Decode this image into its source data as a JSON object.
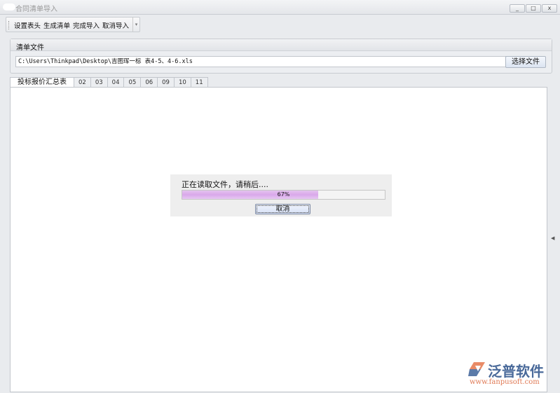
{
  "window": {
    "title": "合同清单导入",
    "minimize": "_",
    "maximize": "□",
    "close": "x"
  },
  "toolbar": {
    "set_header": "设置表头",
    "generate_list": "生成清单",
    "finish_import": "完成导入",
    "cancel_import": "取消导入",
    "more": "▾"
  },
  "file_group": {
    "title": "清单文件",
    "path": "C:\\Users\\Thinkpad\\Desktop\\吉图珲一标 表4-5、4-6.xls",
    "choose_label": "选择文件"
  },
  "tabs": [
    "投标报价汇总表",
    "02",
    "03",
    "04",
    "05",
    "06",
    "09",
    "10",
    "11"
  ],
  "progress": {
    "message": "正在读取文件，请稍后....",
    "percent": 67,
    "percent_label": "67%",
    "cancel_label": "取消"
  },
  "logo": {
    "name": "泛普软件",
    "url": "www.fanpusoft.com"
  },
  "colors": {
    "progress_fill": "#d9a8ea",
    "logo_blue": "#4a6a9a",
    "logo_orange": "#e07a55"
  }
}
